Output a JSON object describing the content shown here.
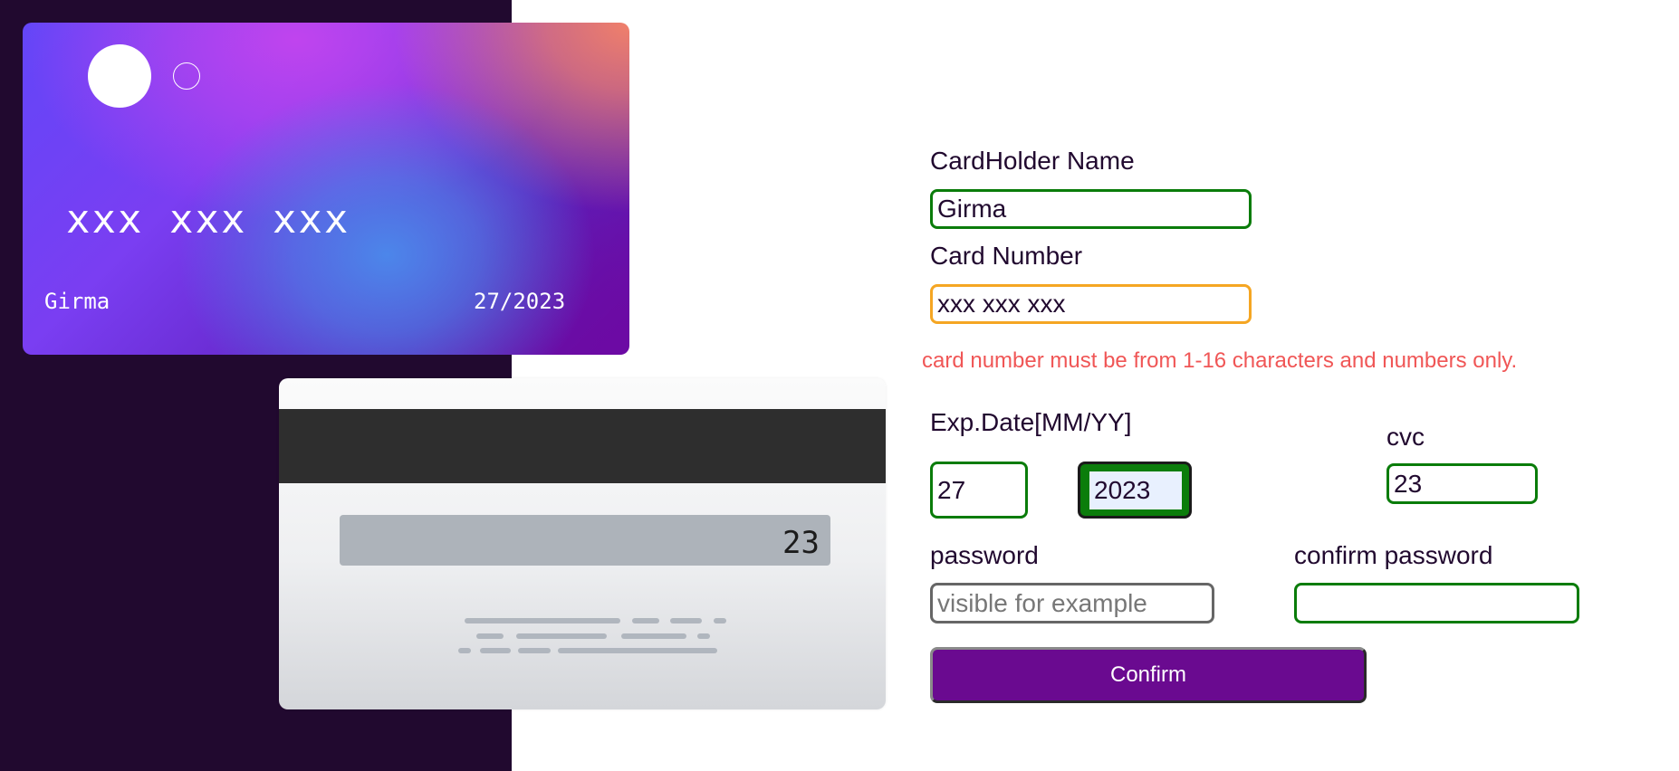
{
  "front_card": {
    "number": "xxx xxx xxx",
    "holder_name": "Girma",
    "expiry": "27/2023"
  },
  "back_card": {
    "cvc": "23"
  },
  "form": {
    "cardholder_label": "CardHolder Name",
    "cardholder_value": "Girma",
    "card_number_label": "Card Number",
    "card_number_value": "xxx xxx xxx",
    "card_number_error": "card number must be from 1-16 characters and numbers only.",
    "exp_label": "Exp.Date[MM/YY]",
    "exp_month_value": "27",
    "exp_year_value": "2023",
    "cvc_label": "cvc",
    "cvc_value": "23",
    "password_label": "password",
    "password_placeholder": "visible for example",
    "password_value": "",
    "confirm_password_label": "confirm password",
    "confirm_password_value": "",
    "confirm_button_label": "Confirm"
  },
  "colors": {
    "dark_panel": "#21092f",
    "valid_border": "#0a7c0a",
    "warning_border": "#f5a623",
    "error_text": "#f05656",
    "button": "#6a0a90"
  }
}
